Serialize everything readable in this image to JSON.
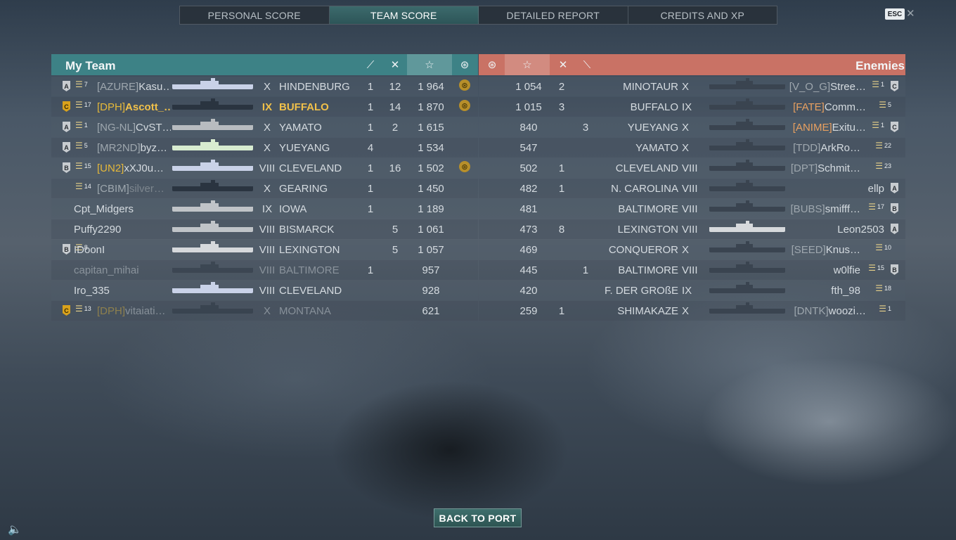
{
  "tabs": [
    "PERSONAL SCORE",
    "TEAM SCORE",
    "DETAILED REPORT",
    "CREDITS AND XP"
  ],
  "active_tab": 1,
  "esc_label": "ESC",
  "left_team": {
    "title": "My Team"
  },
  "right_team": {
    "title": "Enemies"
  },
  "back_button": "BACK TO PORT",
  "my_team": [
    {
      "rank": "A",
      "rank_color": "silver",
      "level": "7",
      "clan": "[AZURE]",
      "name": "Kasu…",
      "tier": "X",
      "ship": "HINDENBURG",
      "c1": "1",
      "c2": "12",
      "score": "1 964",
      "medal": true,
      "style": "normal"
    },
    {
      "rank": "C",
      "rank_color": "gold",
      "level": "17",
      "clan": "[DPH]",
      "name": "Ascott_…",
      "tier": "IX",
      "ship": "BUFFALO",
      "c1": "1",
      "c2": "14",
      "score": "1 870",
      "medal": true,
      "style": "self"
    },
    {
      "rank": "A",
      "rank_color": "silver",
      "level": "1",
      "clan": "[NG-NL]",
      "name": "CvST…",
      "tier": "X",
      "ship": "YAMATO",
      "c1": "1",
      "c2": "2",
      "score": "1 615",
      "medal": false,
      "style": "normal"
    },
    {
      "rank": "A",
      "rank_color": "silver",
      "level": "5",
      "clan": "[MR2ND]",
      "name": "byz…",
      "tier": "X",
      "ship": "YUEYANG",
      "c1": "4",
      "c2": "",
      "score": "1 534",
      "medal": false,
      "style": "normal"
    },
    {
      "rank": "B",
      "rank_color": "silver",
      "level": "15",
      "clan": "[UN2]",
      "name": "xXJ0u…",
      "tier": "VIII",
      "ship": "CLEVELAND",
      "c1": "1",
      "c2": "16",
      "score": "1 502",
      "medal": true,
      "style": "clan-gold"
    },
    {
      "rank": "",
      "rank_color": "",
      "level": "14",
      "clan": "[CBIM]",
      "name": "silver…",
      "tier": "X",
      "ship": "GEARING",
      "c1": "1",
      "c2": "",
      "score": "1 450",
      "medal": false,
      "style": "dead-name"
    },
    {
      "rank": "",
      "rank_color": "",
      "level": "",
      "clan": "",
      "name": "Cpt_Midgers",
      "tier": "IX",
      "ship": "IOWA",
      "c1": "1",
      "c2": "",
      "score": "1 189",
      "medal": false,
      "style": "normal"
    },
    {
      "rank": "",
      "rank_color": "",
      "level": "",
      "clan": "",
      "name": "Puffy2290",
      "tier": "VIII",
      "ship": "BISMARCK",
      "c1": "",
      "c2": "5",
      "score": "1 061",
      "medal": false,
      "style": "normal"
    },
    {
      "rank": "B",
      "rank_color": "silver",
      "level": "8",
      "clan": "",
      "name": "IDoonI",
      "tier": "VIII",
      "ship": "LEXINGTON",
      "c1": "",
      "c2": "5",
      "score": "1 057",
      "medal": false,
      "style": "normal"
    },
    {
      "rank": "",
      "rank_color": "",
      "level": "",
      "clan": "",
      "name": "capitan_mihai",
      "tier": "VIII",
      "ship": "BALTIMORE",
      "c1": "1",
      "c2": "",
      "score": "957",
      "medal": false,
      "style": "dead"
    },
    {
      "rank": "",
      "rank_color": "",
      "level": "",
      "clan": "",
      "name": "Iro_335",
      "tier": "VIII",
      "ship": "CLEVELAND",
      "c1": "",
      "c2": "",
      "score": "928",
      "medal": false,
      "style": "normal"
    },
    {
      "rank": "C",
      "rank_color": "gold",
      "level": "13",
      "clan": "[DPH]",
      "name": "vitaiati…",
      "tier": "X",
      "ship": "MONTANA",
      "c1": "",
      "c2": "",
      "score": "621",
      "medal": false,
      "style": "clan-gold-dead"
    }
  ],
  "enemies": [
    {
      "score": "1 054",
      "c2": "2",
      "c1": "",
      "ship": "MINOTAUR",
      "tier": "X",
      "clan": "[V_O_G]",
      "name": "Stree…",
      "level": "1",
      "rank": "C",
      "style": "normal"
    },
    {
      "score": "1 015",
      "c2": "3",
      "c1": "",
      "ship": "BUFFALO",
      "tier": "IX",
      "clan": "[FATE]",
      "name": "Comm…",
      "level": "5",
      "rank": "",
      "style": "orange-clan"
    },
    {
      "score": "840",
      "c2": "",
      "c1": "3",
      "ship": "YUEYANG",
      "tier": "X",
      "clan": "[ANIME]",
      "name": "Exitu…",
      "level": "1",
      "rank": "C",
      "style": "orange-clan"
    },
    {
      "score": "547",
      "c2": "",
      "c1": "",
      "ship": "YAMATO",
      "tier": "X",
      "clan": "[TDD]",
      "name": "ArkRo…",
      "level": "22",
      "rank": "",
      "style": "normal"
    },
    {
      "score": "502",
      "c2": "1",
      "c1": "",
      "ship": "CLEVELAND",
      "tier": "VIII",
      "clan": "[DPT]",
      "name": "Schmit…",
      "level": "23",
      "rank": "",
      "style": "normal"
    },
    {
      "score": "482",
      "c2": "1",
      "c1": "",
      "ship": "N. CAROLINA",
      "tier": "VIII",
      "clan": "",
      "name": "ellp",
      "level": "",
      "rank": "A",
      "style": "normal"
    },
    {
      "score": "481",
      "c2": "",
      "c1": "",
      "ship": "BALTIMORE",
      "tier": "VIII",
      "clan": "[BUBS]",
      "name": "smifff…",
      "level": "17",
      "rank": "B",
      "style": "normal"
    },
    {
      "score": "473",
      "c2": "8",
      "c1": "",
      "ship": "LEXINGTON",
      "tier": "VIII",
      "clan": "",
      "name": "Leon2503",
      "level": "",
      "rank": "A",
      "style": "normal"
    },
    {
      "score": "469",
      "c2": "",
      "c1": "",
      "ship": "CONQUEROR",
      "tier": "X",
      "clan": "[SEED]",
      "name": "Knus…",
      "level": "10",
      "rank": "",
      "style": "normal"
    },
    {
      "score": "445",
      "c2": "",
      "c1": "1",
      "ship": "BALTIMORE",
      "tier": "VIII",
      "clan": "",
      "name": "w0lfie",
      "level": "15",
      "rank": "B",
      "style": "normal"
    },
    {
      "score": "420",
      "c2": "",
      "c1": "",
      "ship": "F. DER GROßE",
      "tier": "IX",
      "clan": "",
      "name": "fth_98",
      "level": "18",
      "rank": "",
      "style": "normal"
    },
    {
      "score": "259",
      "c2": "1",
      "c1": "",
      "ship": "SHIMAKAZE",
      "tier": "X",
      "clan": "[DNTK]",
      "name": "woozi…",
      "level": "1",
      "rank": "",
      "style": "normal"
    }
  ],
  "colors": {
    "team_header": "#3d8286",
    "enemy_header": "#c97265",
    "gold": "#f0c04a",
    "clan_orange": "#e8a060"
  }
}
